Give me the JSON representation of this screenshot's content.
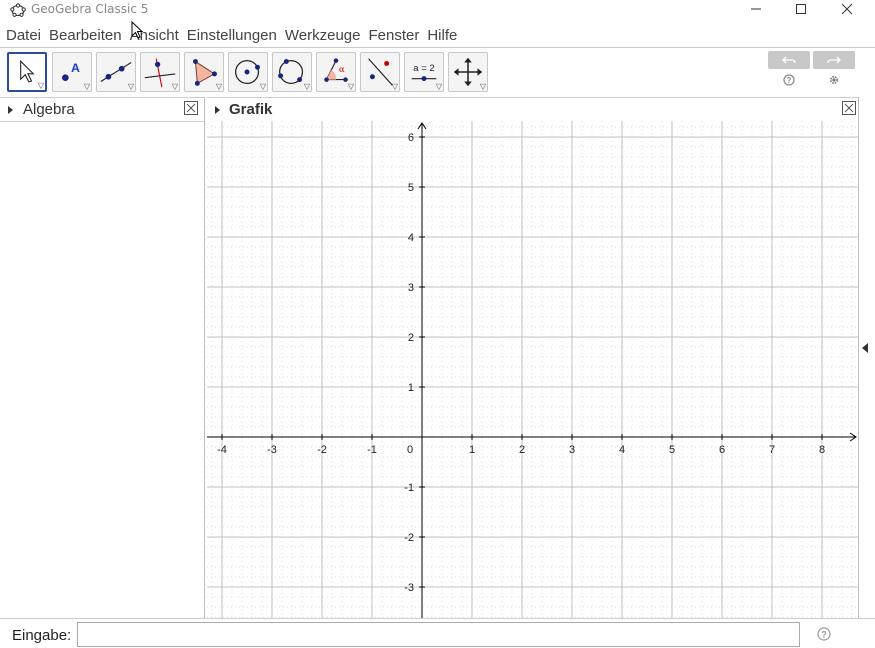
{
  "window": {
    "title": "GeoGebra Classic 5",
    "icon": "geogebra-logo-icon",
    "controls": [
      "minimize-icon",
      "maximize-icon",
      "close-icon"
    ]
  },
  "menu": [
    "Datei",
    "Bearbeiten",
    "Ansicht",
    "Einstellungen",
    "Werkzeuge",
    "Fenster",
    "Hilfe"
  ],
  "toolbar": {
    "tools": [
      {
        "name": "move-tool",
        "icon": "arrow-cursor-icon",
        "selected": true
      },
      {
        "name": "point-tool",
        "icon": "point-a-icon",
        "label": "A"
      },
      {
        "name": "line-tool",
        "icon": "line-through-points-icon"
      },
      {
        "name": "perpendicular-line-tool",
        "icon": "perpendicular-line-icon"
      },
      {
        "name": "polygon-tool",
        "icon": "polygon-icon"
      },
      {
        "name": "circle-center-point-tool",
        "icon": "circle-center-icon"
      },
      {
        "name": "circle-three-points-tool",
        "icon": "circle-three-points-icon"
      },
      {
        "name": "angle-tool",
        "icon": "angle-icon",
        "label": "α"
      },
      {
        "name": "reflect-tool",
        "icon": "reflect-about-line-icon"
      },
      {
        "name": "slider-tool",
        "icon": "slider-icon",
        "label": "a = 2"
      },
      {
        "name": "move-graphics-tool",
        "icon": "move-graphics-view-icon"
      }
    ],
    "undo_icon": "undo-icon",
    "redo_icon": "redo-icon",
    "help_icon": "help-icon",
    "settings_icon": "gear-icon"
  },
  "algebra_panel": {
    "title": "Algebra"
  },
  "graphics_panel": {
    "title": "Grafik"
  },
  "chart_data": {
    "type": "coordinate-grid",
    "xlim": [
      -4.3,
      8.7
    ],
    "ylim": [
      -3.6,
      6.3
    ],
    "x_ticks": [
      "-4",
      "-3",
      "-2",
      "-1",
      "0",
      "1",
      "2",
      "3",
      "4",
      "5",
      "6",
      "7",
      "8"
    ],
    "y_ticks": [
      "6",
      "5",
      "4",
      "3",
      "2",
      "1",
      "-1",
      "-2",
      "-3"
    ],
    "major_grid": 1,
    "minor_grid": 0.2,
    "grid": true,
    "colors": {
      "major": "#c0c0c0",
      "minor": "#d8d8d8",
      "axis": "#000000"
    }
  },
  "input_bar": {
    "label": "Eingabe:",
    "value": "",
    "placeholder": ""
  },
  "colors": {
    "selected_border": "#2c4c9c",
    "point": "#1a237e",
    "polygon_fill": "#f3b4a0",
    "accent_red": "#cc0000"
  }
}
